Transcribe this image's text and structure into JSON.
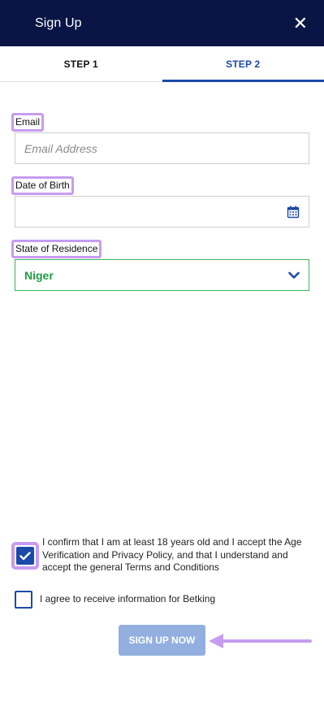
{
  "header": {
    "title": "Sign Up",
    "close_icon": "close-icon",
    "background": "#0a1546"
  },
  "tabs": [
    {
      "label": "STEP 1",
      "active": false
    },
    {
      "label": "STEP 2",
      "active": true
    }
  ],
  "form": {
    "email": {
      "label": "Email",
      "placeholder": "Email Address",
      "value": ""
    },
    "dob": {
      "label": "Date of Birth",
      "value": "",
      "icon": "calendar-icon"
    },
    "state": {
      "label": "State of Residence",
      "value": "Niger",
      "icon": "chevron-down-icon"
    }
  },
  "consents": [
    {
      "text": "I confirm that I am at least 18 years old and I accept the Age Verification and Privacy Policy, and that I understand and accept the general Terms and Conditions",
      "checked": true
    },
    {
      "text": "I agree to receive information for Betking",
      "checked": false
    }
  ],
  "submit_label": "SIGN UP NOW",
  "colors": {
    "accent": "#1b4aa8",
    "highlight": "#c79cf0",
    "select_green": "#1f9a45",
    "submit_bg": "#93afe0"
  }
}
